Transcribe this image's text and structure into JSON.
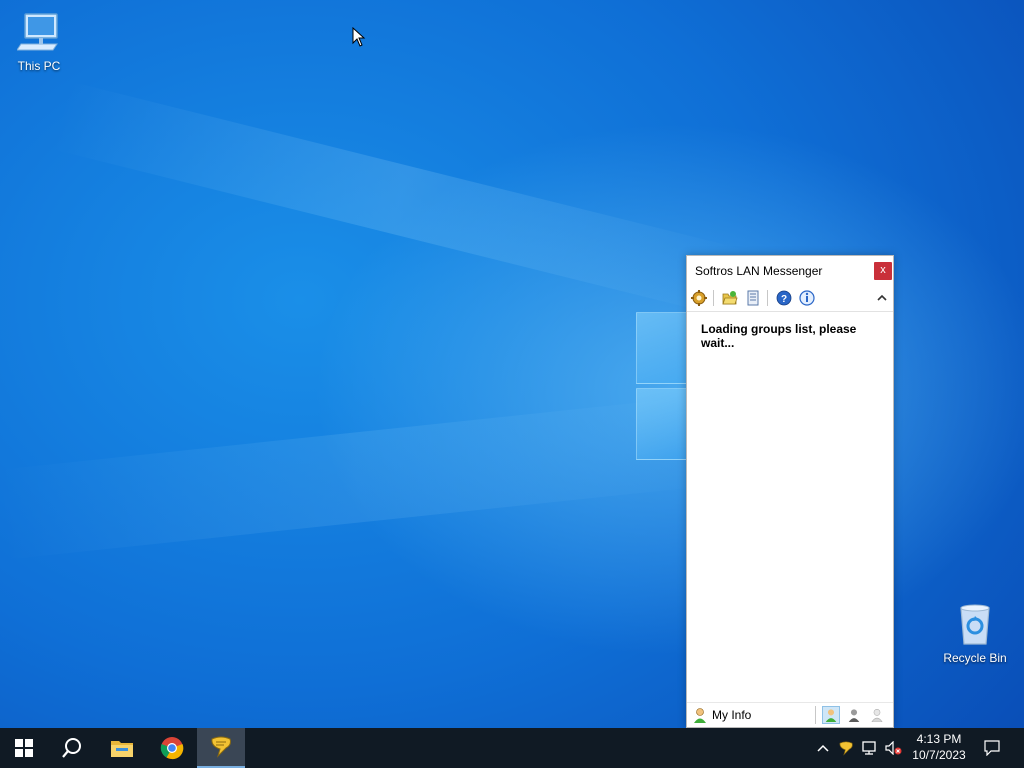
{
  "desktop": {
    "icons": [
      {
        "label": "This PC"
      },
      {
        "label": "Recycle Bin"
      }
    ]
  },
  "messenger": {
    "title": "Softros LAN Messenger",
    "close_label": "x",
    "loading_text": "Loading groups list, please wait...",
    "toolbar_icons": [
      "settings-icon",
      "open-folder-icon",
      "message-log-icon",
      "help-icon",
      "info-icon",
      "collapse-chevron-icon"
    ],
    "status_label": "My Info",
    "status_icons": [
      "status-available-icon",
      "status-away-icon",
      "status-offline-icon"
    ]
  },
  "taskbar": {
    "items": [
      "start-icon",
      "search-icon",
      "file-explorer-icon",
      "chrome-icon",
      "softros-messenger-icon"
    ],
    "tray_icons": [
      "show-hidden-icons-chevron",
      "softros-tray-icon",
      "network-icon",
      "volume-muted-icon",
      "notifications-icon"
    ],
    "time": "4:13 PM",
    "date": "10/7/2023"
  },
  "colors": {
    "close_button": "#c9303a",
    "taskbar": "#101a24",
    "desktop_blue": "#0f6fd6"
  }
}
